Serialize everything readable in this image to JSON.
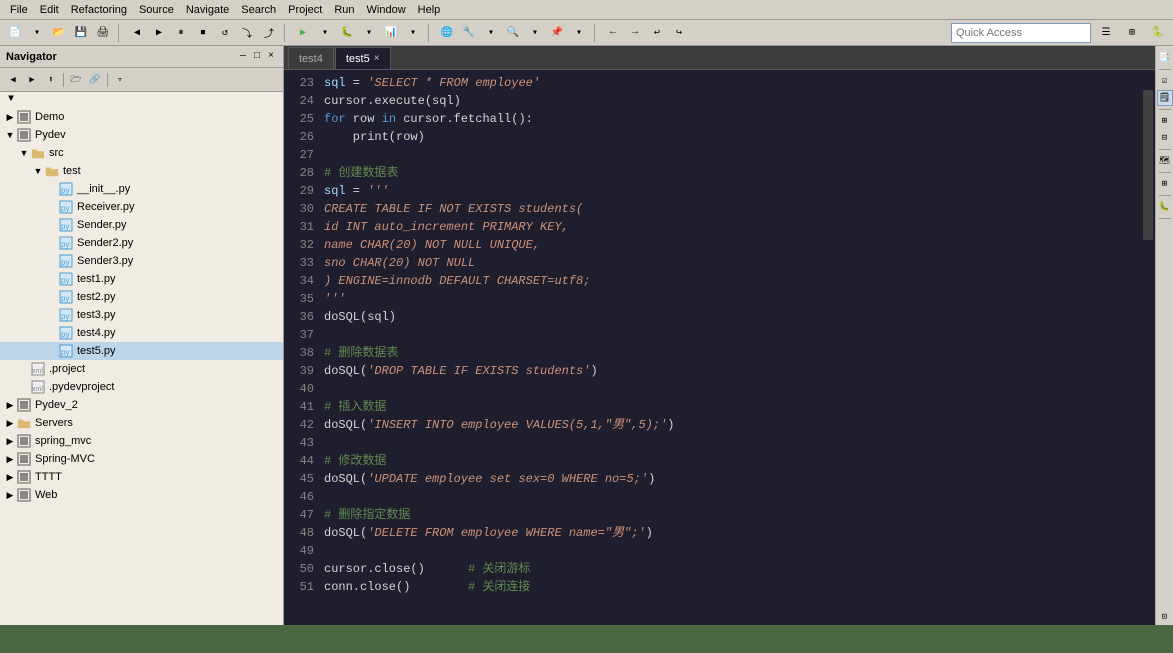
{
  "menubar": {
    "items": [
      "File",
      "Edit",
      "Refactoring",
      "Source",
      "Navigate",
      "Search",
      "Project",
      "Run",
      "Window",
      "Help"
    ]
  },
  "quickaccess": {
    "label": "Quick Access",
    "placeholder": "Quick Access"
  },
  "navigator": {
    "title": "Navigator",
    "close_label": "×",
    "minimize_label": "—",
    "maximize_label": "□",
    "tree": [
      {
        "id": "demo",
        "label": "Demo",
        "level": 0,
        "type": "project",
        "expanded": false,
        "arrow": "▶"
      },
      {
        "id": "pydev",
        "label": "Pydev",
        "level": 0,
        "type": "project",
        "expanded": true,
        "arrow": "▼"
      },
      {
        "id": "src",
        "label": "src",
        "level": 1,
        "type": "folder",
        "expanded": true,
        "arrow": "▼"
      },
      {
        "id": "test",
        "label": "test",
        "level": 2,
        "type": "folder",
        "expanded": true,
        "arrow": "▼"
      },
      {
        "id": "init",
        "label": "__init__.py",
        "level": 3,
        "type": "py",
        "expanded": false,
        "arrow": ""
      },
      {
        "id": "receiver",
        "label": "Receiver.py",
        "level": 3,
        "type": "py",
        "expanded": false,
        "arrow": ""
      },
      {
        "id": "sender",
        "label": "Sender.py",
        "level": 3,
        "type": "py",
        "expanded": false,
        "arrow": ""
      },
      {
        "id": "sender2",
        "label": "Sender2.py",
        "level": 3,
        "type": "py",
        "expanded": false,
        "arrow": ""
      },
      {
        "id": "sender3",
        "label": "Sender3.py",
        "level": 3,
        "type": "py",
        "expanded": false,
        "arrow": ""
      },
      {
        "id": "test1",
        "label": "test1.py",
        "level": 3,
        "type": "py",
        "expanded": false,
        "arrow": ""
      },
      {
        "id": "test2",
        "label": "test2.py",
        "level": 3,
        "type": "py",
        "expanded": false,
        "arrow": ""
      },
      {
        "id": "test3",
        "label": "test3.py",
        "level": 3,
        "type": "py",
        "expanded": false,
        "arrow": ""
      },
      {
        "id": "test4",
        "label": "test4.py",
        "level": 3,
        "type": "py",
        "expanded": false,
        "arrow": ""
      },
      {
        "id": "test5",
        "label": "test5.py",
        "level": 3,
        "type": "py",
        "expanded": false,
        "arrow": "",
        "active": true
      },
      {
        "id": "dotproject",
        "label": ".project",
        "level": 1,
        "type": "xml",
        "expanded": false,
        "arrow": ""
      },
      {
        "id": "dotpydev",
        "label": ".pydevproject",
        "level": 1,
        "type": "xml",
        "expanded": false,
        "arrow": ""
      },
      {
        "id": "pydev2",
        "label": "Pydev_2",
        "level": 0,
        "type": "project",
        "expanded": false,
        "arrow": "▶"
      },
      {
        "id": "servers",
        "label": "Servers",
        "level": 0,
        "type": "folder",
        "expanded": false,
        "arrow": "▶"
      },
      {
        "id": "spring_mvc",
        "label": "spring_mvc",
        "level": 0,
        "type": "project",
        "expanded": false,
        "arrow": "▶"
      },
      {
        "id": "spring_MVC",
        "label": "Spring-MVC",
        "level": 0,
        "type": "project",
        "expanded": false,
        "arrow": "▶"
      },
      {
        "id": "tttt",
        "label": "TTTT",
        "level": 0,
        "type": "project",
        "expanded": false,
        "arrow": "▶"
      },
      {
        "id": "web",
        "label": "Web",
        "level": 0,
        "type": "project",
        "expanded": false,
        "arrow": "▶"
      }
    ]
  },
  "tabs": [
    {
      "id": "test4",
      "label": "test4",
      "active": false,
      "closable": false
    },
    {
      "id": "test5",
      "label": "test5",
      "active": true,
      "closable": true
    }
  ],
  "code": {
    "lines": [
      {
        "num": 23,
        "content": "sql = 'SELECT * FROM employee'",
        "tokens": [
          {
            "t": "var",
            "v": "sql"
          },
          {
            "t": "punc",
            "v": " = "
          },
          {
            "t": "str",
            "v": "'SELECT * FROM employee'"
          }
        ]
      },
      {
        "num": 24,
        "content": "cursor.execute(sql)",
        "tokens": [
          {
            "t": "fn",
            "v": "cursor.execute(sql)"
          }
        ]
      },
      {
        "num": 25,
        "content": "for row in cursor.fetchall():",
        "tokens": [
          {
            "t": "kw",
            "v": "for"
          },
          {
            "t": "fn",
            "v": " row "
          },
          {
            "t": "kw",
            "v": "in"
          },
          {
            "t": "fn",
            "v": " cursor.fetchall():"
          }
        ]
      },
      {
        "num": 26,
        "content": "    print(row)",
        "tokens": [
          {
            "t": "fn",
            "v": "    print(row)"
          }
        ]
      },
      {
        "num": 27,
        "content": "",
        "tokens": []
      },
      {
        "num": 28,
        "content": "# 创建数据表",
        "tokens": [
          {
            "t": "comment",
            "v": "# 创建数据表"
          }
        ]
      },
      {
        "num": 29,
        "content": "sql = '''",
        "tokens": [
          {
            "t": "var",
            "v": "sql"
          },
          {
            "t": "punc",
            "v": " = "
          },
          {
            "t": "str",
            "v": "'''"
          }
        ]
      },
      {
        "num": 30,
        "content": "CREATE TABLE IF NOT EXISTS students(",
        "tokens": [
          {
            "t": "str",
            "v": "CREATE TABLE IF NOT EXISTS students("
          }
        ]
      },
      {
        "num": 31,
        "content": "id INT auto_increment PRIMARY KEY,",
        "tokens": [
          {
            "t": "str",
            "v": "id INT auto_increment PRIMARY KEY,"
          }
        ]
      },
      {
        "num": 32,
        "content": "name CHAR(20) NOT NULL UNIQUE,",
        "tokens": [
          {
            "t": "str",
            "v": "name CHAR(20) NOT NULL UNIQUE,"
          }
        ]
      },
      {
        "num": 33,
        "content": "sno CHAR(20) NOT NULL",
        "tokens": [
          {
            "t": "str",
            "v": "sno CHAR(20) NOT NULL"
          }
        ]
      },
      {
        "num": 34,
        "content": ") ENGINE=innodb DEFAULT CHARSET=utf8;",
        "tokens": [
          {
            "t": "str",
            "v": ") ENGINE=innodb DEFAULT CHARSET=utf8;"
          }
        ]
      },
      {
        "num": 35,
        "content": "'''",
        "tokens": [
          {
            "t": "str",
            "v": "'''"
          }
        ]
      },
      {
        "num": 36,
        "content": "doSQL(sql)",
        "tokens": [
          {
            "t": "fn",
            "v": "doSQL(sql)"
          }
        ]
      },
      {
        "num": 37,
        "content": "",
        "tokens": []
      },
      {
        "num": 38,
        "content": "# 删除数据表",
        "tokens": [
          {
            "t": "comment",
            "v": "# 删除数据表"
          }
        ]
      },
      {
        "num": 39,
        "content": "doSQL('DROP TABLE IF EXISTS students')",
        "tokens": [
          {
            "t": "fn",
            "v": "doSQL("
          },
          {
            "t": "str",
            "v": "'DROP TABLE IF EXISTS students'"
          },
          {
            "t": "fn",
            "v": ")"
          }
        ]
      },
      {
        "num": 40,
        "content": "",
        "tokens": []
      },
      {
        "num": 41,
        "content": "# 插入数据",
        "tokens": [
          {
            "t": "comment",
            "v": "# 插入数据"
          }
        ]
      },
      {
        "num": 42,
        "content": "doSQL('INSERT INTO employee VALUES(5,1,\"男\",5);')",
        "tokens": [
          {
            "t": "fn",
            "v": "doSQL("
          },
          {
            "t": "str",
            "v": "'INSERT INTO employee VALUES(5,1,\"男\",5);'"
          },
          {
            "t": "fn",
            "v": ")"
          }
        ]
      },
      {
        "num": 43,
        "content": "",
        "tokens": []
      },
      {
        "num": 44,
        "content": "# 修改数据",
        "tokens": [
          {
            "t": "comment",
            "v": "# 修改数据"
          }
        ]
      },
      {
        "num": 45,
        "content": "doSQL('UPDATE employee set sex=0 WHERE no=5;')",
        "tokens": [
          {
            "t": "fn",
            "v": "doSQL("
          },
          {
            "t": "str",
            "v": "'UPDATE employee set sex=0 WHERE no=5;'"
          },
          {
            "t": "fn",
            "v": ")"
          }
        ]
      },
      {
        "num": 46,
        "content": "",
        "tokens": []
      },
      {
        "num": 47,
        "content": "# 删除指定数据",
        "tokens": [
          {
            "t": "comment",
            "v": "# 删除指定数据"
          }
        ]
      },
      {
        "num": 48,
        "content": "doSQL('DELETE FROM employee WHERE name=\"男\";')",
        "tokens": [
          {
            "t": "fn",
            "v": "doSQL("
          },
          {
            "t": "str",
            "v": "'DELETE FROM employee WHERE name=\"男\";'"
          },
          {
            "t": "fn",
            "v": ")"
          }
        ]
      },
      {
        "num": 49,
        "content": "",
        "tokens": []
      },
      {
        "num": 50,
        "content": "cursor.close()      # 关闭游标",
        "tokens": [
          {
            "t": "fn",
            "v": "cursor.close()      "
          },
          {
            "t": "comment",
            "v": "# 关闭游标"
          }
        ]
      },
      {
        "num": 51,
        "content": "conn.close()        # 关闭连接",
        "tokens": [
          {
            "t": "fn",
            "v": "conn.close()        "
          },
          {
            "t": "comment",
            "v": "# 关闭连接"
          }
        ]
      }
    ]
  }
}
